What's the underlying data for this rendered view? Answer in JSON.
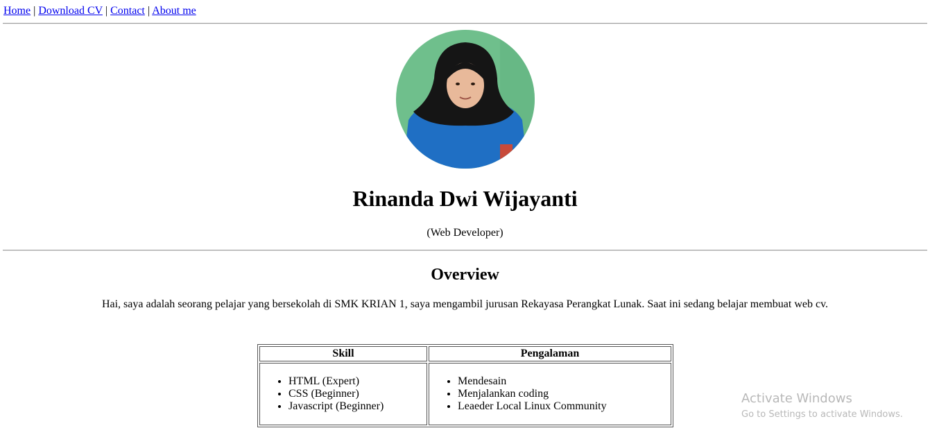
{
  "nav": {
    "links": [
      "Home",
      "Download CV",
      "Contact",
      "About me"
    ],
    "separator": "|"
  },
  "profile": {
    "photo": "profile-photo",
    "name": "Rinanda Dwi Wijayanti",
    "role": "(Web Developer)"
  },
  "overview": {
    "title": "Overview",
    "text": "Hai, saya adalah seorang pelajar yang bersekolah di SMK KRIAN 1, saya mengambil jurusan Rekayasa Perangkat Lunak. Saat ini sedang belajar membuat web cv."
  },
  "table": {
    "headers": [
      "Skill",
      "Pengalaman"
    ],
    "skills": [
      "HTML (Expert)",
      "CSS (Beginner)",
      "Javascript (Beginner)"
    ],
    "experience": [
      "Mendesain",
      "Menjalankan coding",
      "Leaeder Local Linux Community"
    ]
  },
  "watermark": {
    "title": "Activate Windows",
    "subtitle": "Go to Settings to activate Windows."
  },
  "colors": {
    "link": "#0000ee",
    "photo_background": "#6fbf8c",
    "shirt": "#1f6fc4",
    "hijab": "#151515"
  }
}
